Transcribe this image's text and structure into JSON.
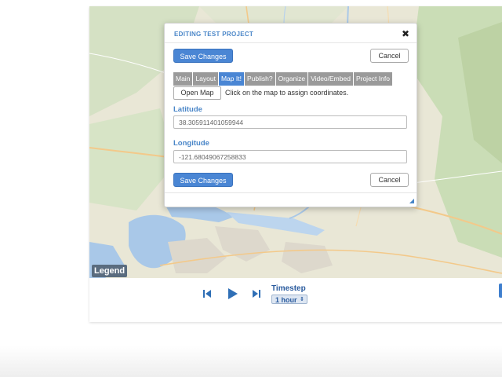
{
  "modal": {
    "title": "EDITING TEST PROJECT",
    "close_glyph": "✖",
    "save_label": "Save Changes",
    "cancel_label": "Cancel",
    "tabs": [
      {
        "label": "Main",
        "active": false
      },
      {
        "label": "Layout",
        "active": false
      },
      {
        "label": "Map It!",
        "active": true
      },
      {
        "label": "Publish?",
        "active": false
      },
      {
        "label": "Organize",
        "active": false
      },
      {
        "label": "Video/Embed",
        "active": false
      },
      {
        "label": "Project Info",
        "active": false
      }
    ],
    "open_map_label": "Open Map",
    "map_hint": "Click on the map to assign coordinates.",
    "latitude_label": "Latitude",
    "latitude_value": "38.305911401059944",
    "longitude_label": "Longitude",
    "longitude_value": "-121.68049067258833"
  },
  "map": {
    "legend_label": "Legend"
  },
  "controls": {
    "timestep_label": "Timestep",
    "timestep_value": "1 hour",
    "icons": [
      "skip-back-icon",
      "play-icon",
      "skip-forward-icon"
    ]
  },
  "colors": {
    "accent": "#4a86d4",
    "tab_inactive": "#9a9a9a",
    "map_base": "#e9e7d6",
    "water": "#a9c8e8"
  }
}
